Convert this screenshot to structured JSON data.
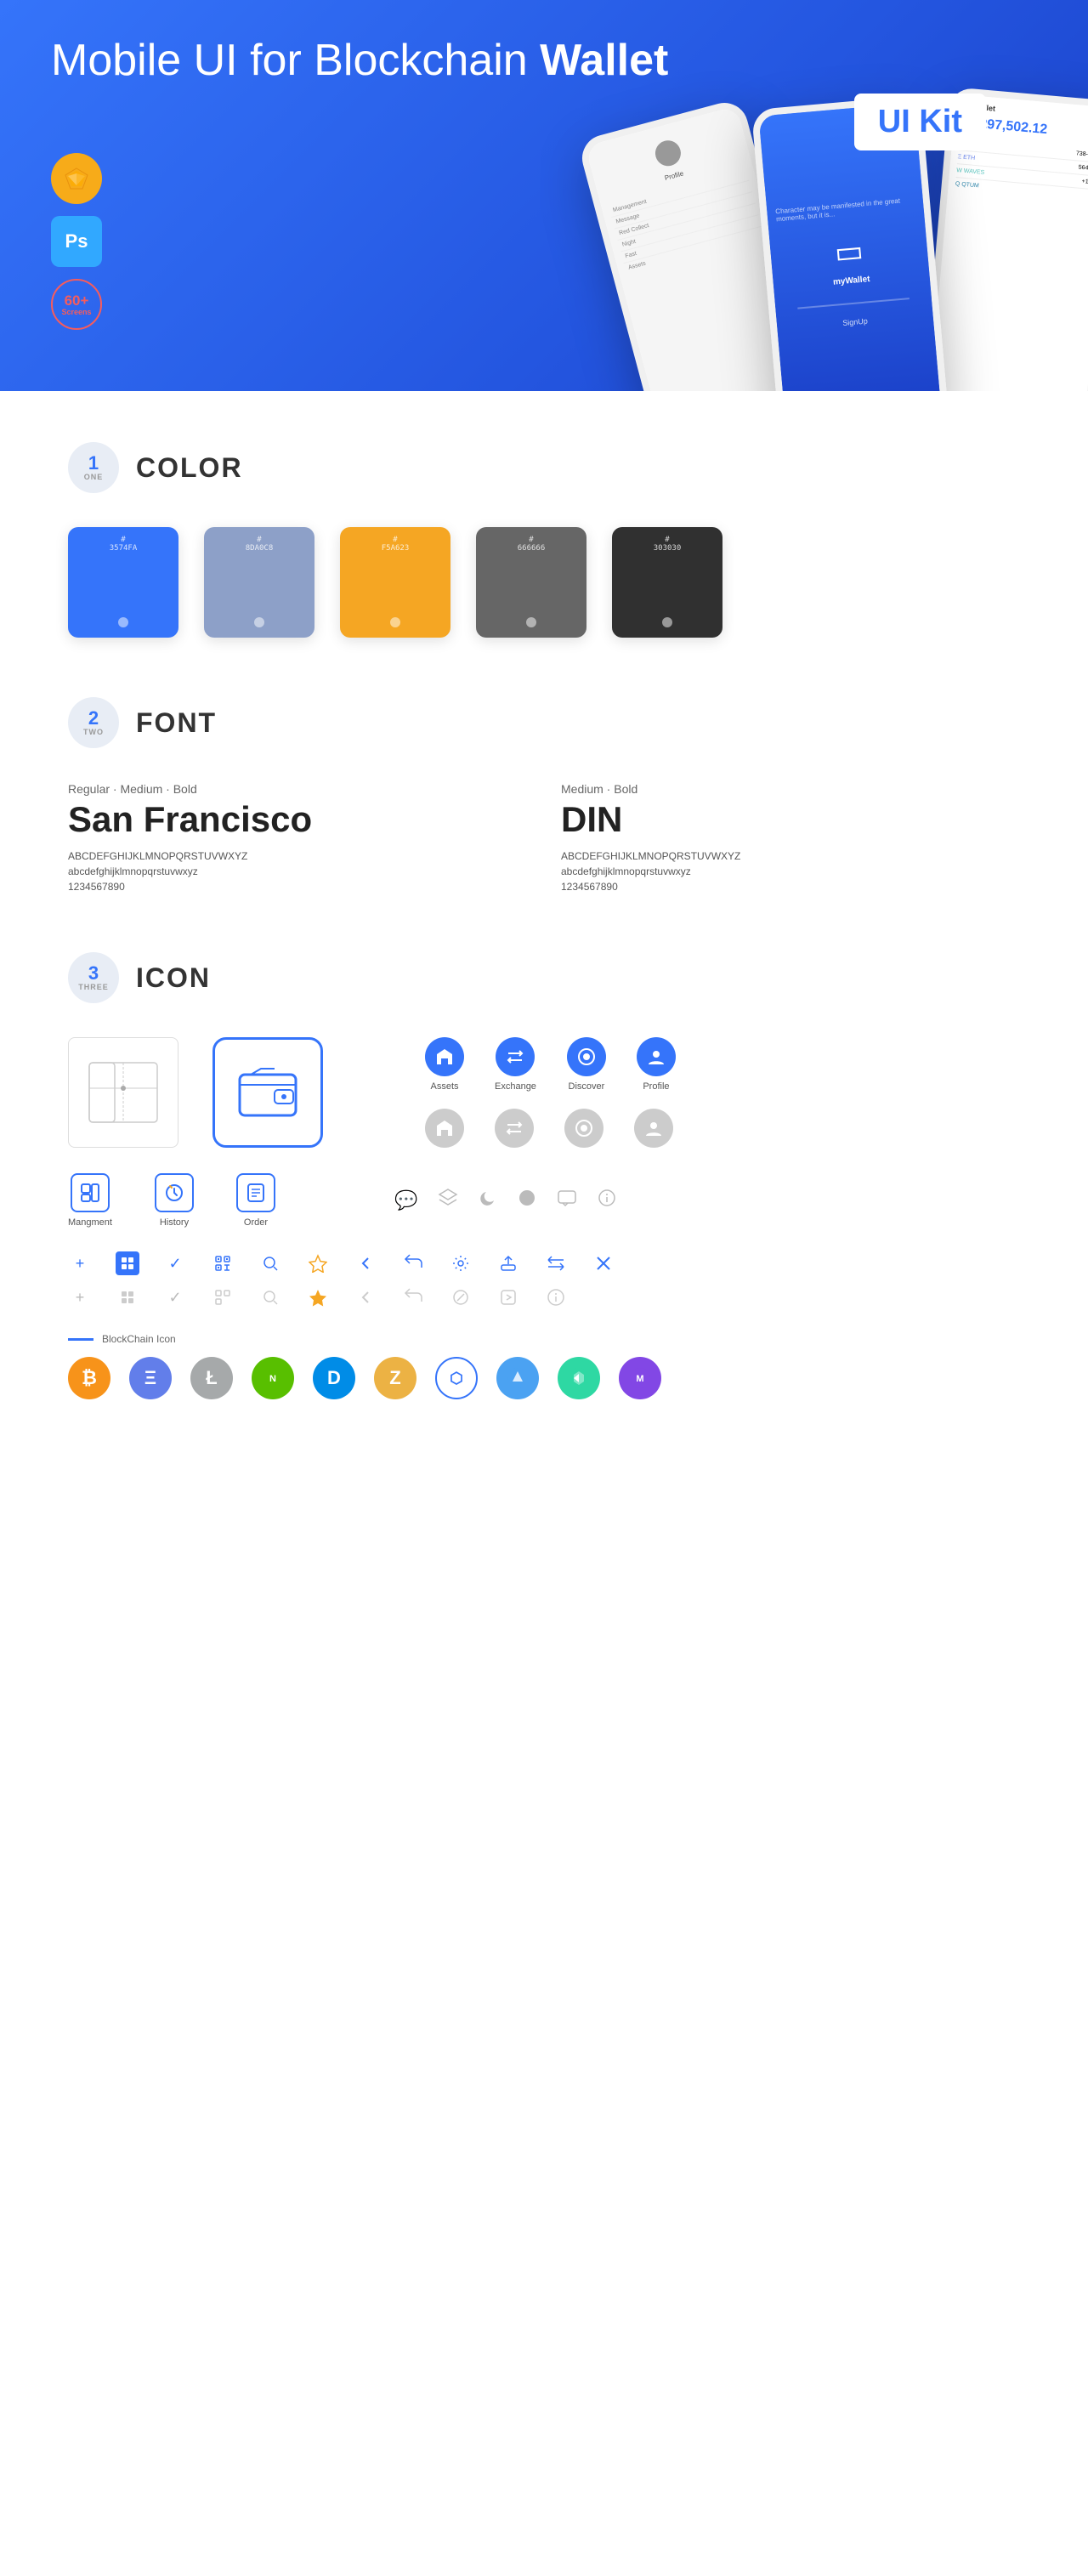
{
  "hero": {
    "title_normal": "Mobile UI for Blockchain ",
    "title_bold": "Wallet",
    "badge": "UI Kit",
    "badges": [
      {
        "id": "sketch",
        "symbol": "◇",
        "label": "Sketch"
      },
      {
        "id": "ps",
        "symbol": "Ps",
        "label": "Photoshop"
      },
      {
        "id": "screens",
        "count": "60+",
        "label": "Screens"
      }
    ]
  },
  "sections": {
    "color": {
      "number": "1",
      "word": "ONE",
      "title": "COLOR",
      "swatches": [
        {
          "id": "blue",
          "hex": "#3574FA",
          "label": "#3574FA"
        },
        {
          "id": "gray-blue",
          "hex": "#8DA0C8",
          "label": "#8DA0C8"
        },
        {
          "id": "orange",
          "hex": "#F5A623",
          "label": "#F5A623"
        },
        {
          "id": "dark-gray",
          "hex": "#666666",
          "label": "#666666"
        },
        {
          "id": "black",
          "hex": "#303030",
          "label": "#303030"
        }
      ]
    },
    "font": {
      "number": "2",
      "word": "TWO",
      "title": "FONT",
      "fonts": [
        {
          "id": "sf",
          "weights": "Regular · Medium · Bold",
          "name": "San Francisco",
          "uppercase": "ABCDEFGHIJKLMNOPQRSTUVWXYZ",
          "lowercase": "abcdefghijklmnopqrstuvwxyz",
          "numbers": "1234567890"
        },
        {
          "id": "din",
          "weights": "Medium · Bold",
          "name": "DIN",
          "uppercase": "ABCDEFGHIJKLMNOPQRSTUVWXYZ",
          "lowercase": "abcdefghijklmnopqrstuvwxyz",
          "numbers": "1234567890"
        }
      ]
    },
    "icon": {
      "number": "3",
      "word": "THREE",
      "title": "ICON",
      "nav_icons": [
        {
          "id": "assets",
          "label": "Assets",
          "symbol": "◆"
        },
        {
          "id": "exchange",
          "label": "Exchange",
          "symbol": "⇄"
        },
        {
          "id": "discover",
          "label": "Discover",
          "symbol": "●"
        },
        {
          "id": "profile",
          "label": "Profile",
          "symbol": "👤"
        }
      ],
      "nav_icons_gray": [
        {
          "id": "assets-g",
          "label": "",
          "symbol": "◆"
        },
        {
          "id": "exchange-g",
          "label": "",
          "symbol": "⇄"
        },
        {
          "id": "discover-g",
          "label": "",
          "symbol": "●"
        },
        {
          "id": "profile-g",
          "label": "",
          "symbol": "👤"
        }
      ],
      "mgmt_icons": [
        {
          "id": "management",
          "label": "Mangment",
          "symbol": "▦"
        },
        {
          "id": "history",
          "label": "History",
          "symbol": "⏱"
        },
        {
          "id": "order",
          "label": "Order",
          "symbol": "📋"
        }
      ],
      "small_icons_colored": [
        "+",
        "⊞",
        "✓",
        "⊡",
        "🔍",
        "☆",
        "<",
        "<>",
        "⚙",
        "↑",
        "⇄",
        "✕"
      ],
      "small_icons_gray": [
        "+",
        "⊞",
        "✓",
        "⊡",
        "🔍",
        "☆",
        "<",
        "<>",
        "✕",
        "⊞",
        "ℹ"
      ],
      "blockchain_label": "BlockChain Icon",
      "crypto_icons": [
        {
          "id": "btc",
          "symbol": "₿",
          "class": "crypto-btc"
        },
        {
          "id": "eth",
          "symbol": "Ξ",
          "class": "crypto-eth"
        },
        {
          "id": "ltc",
          "symbol": "Ł",
          "class": "crypto-ltc"
        },
        {
          "id": "neo",
          "symbol": "N",
          "class": "crypto-neo"
        },
        {
          "id": "dash",
          "symbol": "D",
          "class": "crypto-dash"
        },
        {
          "id": "zcash",
          "symbol": "Z",
          "class": "crypto-zcash"
        },
        {
          "id": "grid",
          "symbol": "⬡",
          "class": "crypto-grid"
        },
        {
          "id": "steem",
          "symbol": "S",
          "class": "crypto-steem"
        },
        {
          "id": "dcr",
          "symbol": "▼",
          "class": "crypto-dcr"
        },
        {
          "id": "matic",
          "symbol": "M",
          "class": "crypto-matic"
        }
      ],
      "misc_icons_labels": [
        "💬",
        "≡",
        "☽",
        "⊙",
        "💬",
        "ℹ"
      ]
    }
  }
}
